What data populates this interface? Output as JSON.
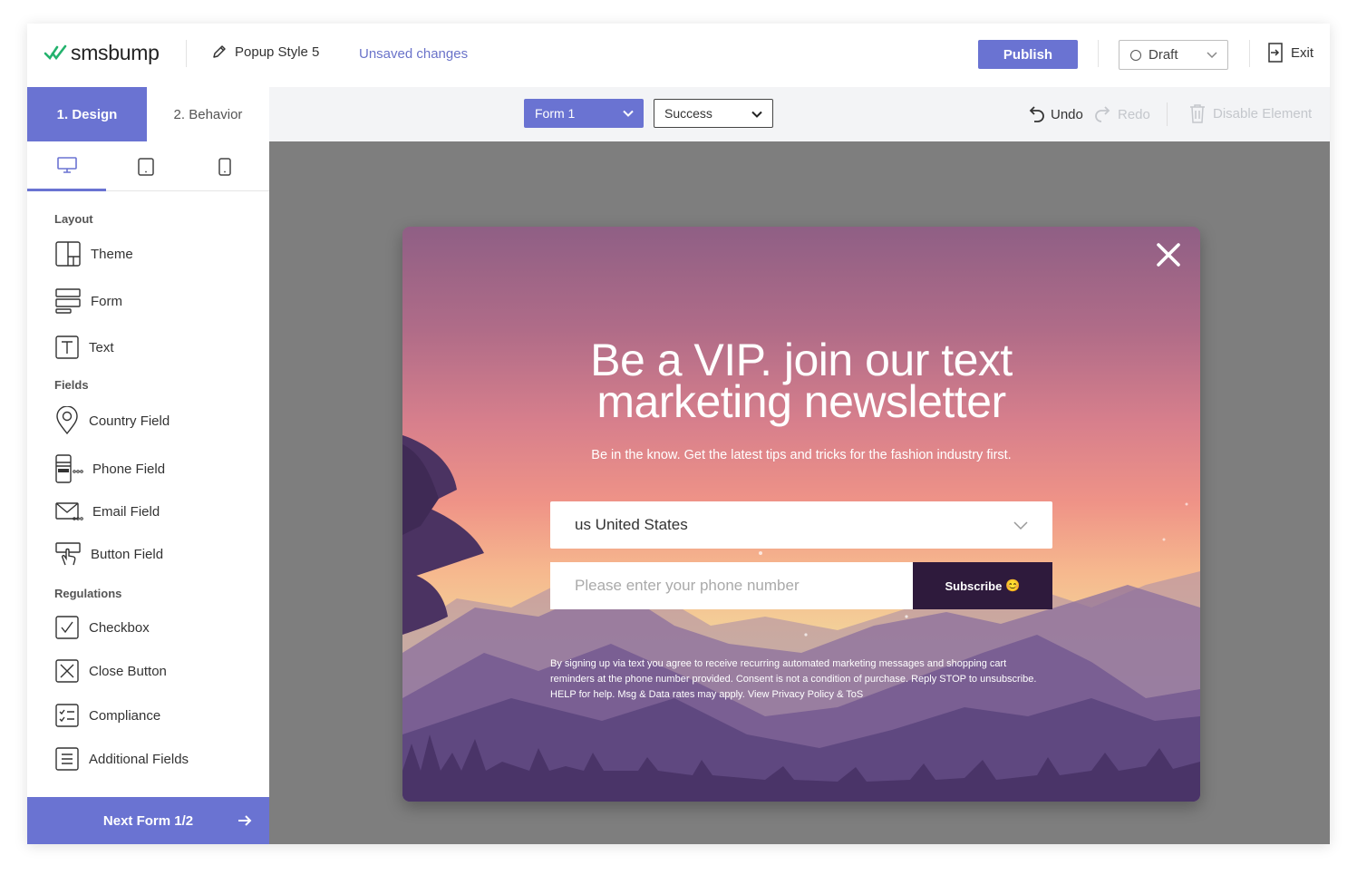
{
  "header": {
    "logo_text": "smsbump",
    "popup_name": "Popup Style 5",
    "unsaved": "Unsaved changes",
    "publish_label": "Publish",
    "status_value": "Draft",
    "exit_label": "Exit"
  },
  "toolbar": {
    "tabs": [
      {
        "label": "1. Design",
        "active": true
      },
      {
        "label": "2. Behavior",
        "active": false
      }
    ],
    "form_select": "Form 1",
    "state_select": "Success",
    "undo_label": "Undo",
    "redo_label": "Redo",
    "disable_label": "Disable Element"
  },
  "sidebar": {
    "devices": [
      "desktop-icon",
      "tablet-icon",
      "mobile-icon"
    ],
    "sections": {
      "layout": "Layout",
      "fields": "Fields",
      "regulations": "Regulations"
    },
    "items": {
      "theme": "Theme",
      "form": "Form",
      "text": "Text",
      "country": "Country Field",
      "phone": "Phone Field",
      "email": "Email Field",
      "button": "Button Field",
      "checkbox": "Checkbox",
      "close": "Close Button",
      "compliance": "Compliance",
      "additional": "Additional Fields"
    },
    "next_label": "Next Form 1/2"
  },
  "popup": {
    "headline_line1": "Be a VIP. join our text",
    "headline_line2": "marketing newsletter",
    "subline": "Be in the know. Get the latest tips and tricks for the fashion industry first.",
    "country_value": "us United States",
    "phone_placeholder": "Please enter your phone number",
    "subscribe_label": "Subscribe",
    "subscribe_emoji": "😊",
    "legal": "By signing up via text you agree to receive recurring automated marketing messages and shopping cart reminders at the phone number provided. Consent is not a condition of purchase. Reply STOP to unsubscribe. HELP for help. Msg & Data rates may apply. View Privacy Policy & ToS"
  },
  "colors": {
    "accent": "#6a73d2",
    "canvas_bg": "#7e7e7e",
    "subscribe_bg": "#2e1a3c"
  }
}
